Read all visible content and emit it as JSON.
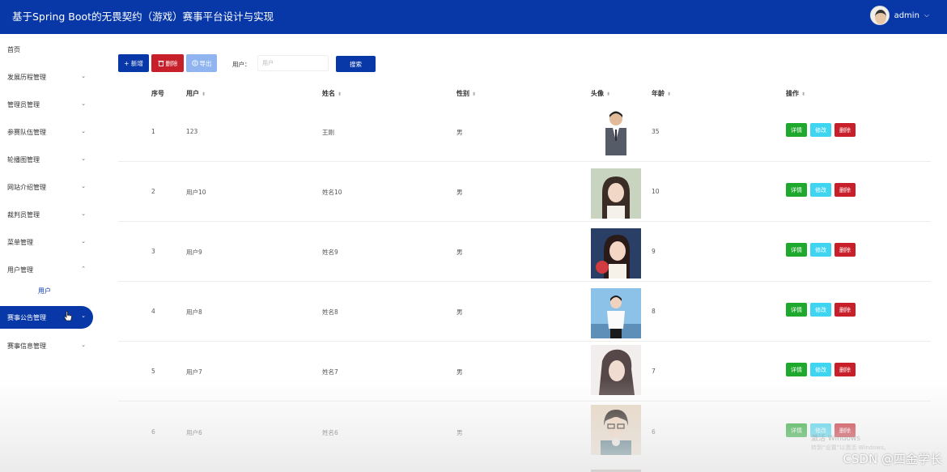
{
  "header": {
    "title": "基于Spring Boot的无畏契约（游戏）赛事平台设计与实现",
    "username": "admin",
    "caret": "⌵"
  },
  "sidebar": {
    "items": [
      {
        "label": "首页"
      },
      {
        "label": "发展历程管理"
      },
      {
        "label": "管理员管理"
      },
      {
        "label": "参赛队伍管理"
      },
      {
        "label": "轮播图管理"
      },
      {
        "label": "网站介绍管理"
      },
      {
        "label": "裁判员管理"
      },
      {
        "label": "菜单管理"
      },
      {
        "label": "用户管理"
      },
      {
        "label": "赛事公告管理"
      },
      {
        "label": "赛事信息管理"
      }
    ],
    "sub_item": "用户",
    "chevron_down": "⌄",
    "chevron_up": "⌃"
  },
  "toolbar": {
    "add_label": "+ 新增",
    "delete_label": "删除",
    "export_label": "导出",
    "search_label": "用户：",
    "search_placeholder": "用户",
    "search_button": "搜索"
  },
  "table": {
    "headers": {
      "index": "序号",
      "user": "用户",
      "name": "姓名",
      "gender": "性别",
      "avatar": "头像",
      "age": "年龄",
      "actions": "操作"
    },
    "sort_icon": "⬍",
    "rows": [
      {
        "index": "1",
        "user": "123",
        "name": "王刚",
        "gender": "男",
        "age": "35"
      },
      {
        "index": "2",
        "user": "用户10",
        "name": "姓名10",
        "gender": "男",
        "age": "10"
      },
      {
        "index": "3",
        "user": "用户9",
        "name": "姓名9",
        "gender": "男",
        "age": "9"
      },
      {
        "index": "4",
        "user": "用户8",
        "name": "姓名8",
        "gender": "男",
        "age": "8"
      },
      {
        "index": "5",
        "user": "用户7",
        "name": "姓名7",
        "gender": "男",
        "age": "7"
      },
      {
        "index": "6",
        "user": "用户6",
        "name": "姓名6",
        "gender": "男",
        "age": "6"
      }
    ],
    "actions": {
      "detail": "详情",
      "edit": "修改",
      "delete": "删除"
    }
  },
  "watermark": "CSDN @四金学长",
  "windows_mark": "激活 Windows",
  "windows_mark_sub": "转到“设置”以激活 Windows。"
}
